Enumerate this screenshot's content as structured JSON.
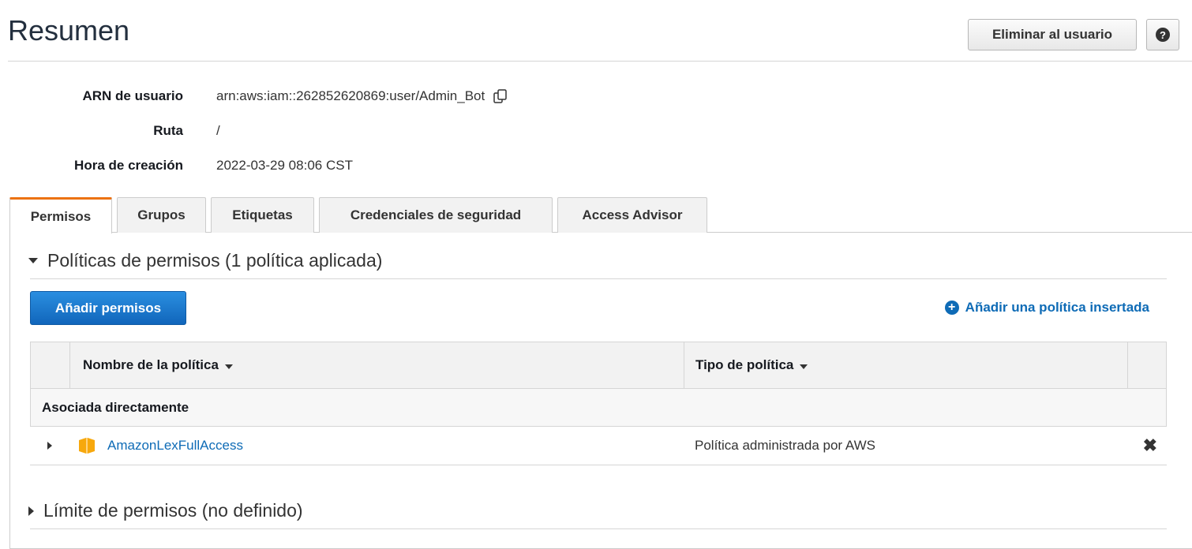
{
  "header": {
    "title": "Resumen",
    "delete_user_label": "Eliminar al usuario",
    "help_icon": "?"
  },
  "summary": {
    "arn_label": "ARN de usuario",
    "arn_value": "arn:aws:iam::262852620869:user/Admin_Bot",
    "path_label": "Ruta",
    "path_value": "/",
    "created_label": "Hora de creación",
    "created_value": "2022-03-29 08:06 CST"
  },
  "tabs": [
    {
      "label": "Permisos",
      "active": true
    },
    {
      "label": "Grupos",
      "active": false
    },
    {
      "label": "Etiquetas",
      "active": false
    },
    {
      "label": "Credenciales de seguridad",
      "active": false
    },
    {
      "label": "Access Advisor",
      "active": false
    }
  ],
  "permissions": {
    "section_title": "Políticas de permisos (1 política aplicada)",
    "add_permissions_label": "Añadir permisos",
    "add_inline_policy_label": "Añadir una política insertada",
    "table": {
      "columns": [
        "Nombre de la política",
        "Tipo de política"
      ],
      "group_label": "Asociada directamente",
      "rows": [
        {
          "name": "AmazonLexFullAccess",
          "type": "Política administrada por AWS"
        }
      ]
    },
    "boundary_title": "Límite de permisos (no definido)"
  },
  "colors": {
    "accent_tab": "#ec7211",
    "primary_button": "#1166bb",
    "link": "#0e6bb6",
    "policy_icon": "#f7a80d"
  }
}
